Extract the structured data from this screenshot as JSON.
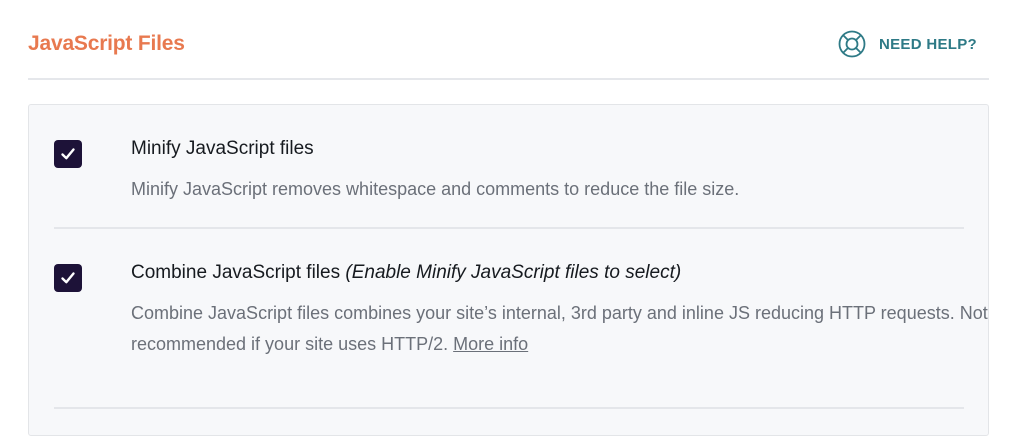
{
  "header": {
    "title": "JavaScript Files",
    "help_label": "NEED HELP?",
    "help_icon": "lifebuoy-icon"
  },
  "options": [
    {
      "title": "Minify JavaScript files",
      "note": "",
      "checked": true,
      "description": "Minify JavaScript removes whitespace and comments to reduce the file size."
    },
    {
      "title": "Combine JavaScript files",
      "note": "(Enable Minify JavaScript files to select)",
      "checked": true,
      "description": "Combine JavaScript files combines your site’s internal, 3rd party and inline JS reducing HTTP requests. Not recommended if your site uses HTTP/2.",
      "link_label": "More info"
    }
  ],
  "colors": {
    "accent": "#e8794f",
    "help": "#2e7a86",
    "checkbox": "#1d1238",
    "panel_bg": "#f7f8fa"
  }
}
